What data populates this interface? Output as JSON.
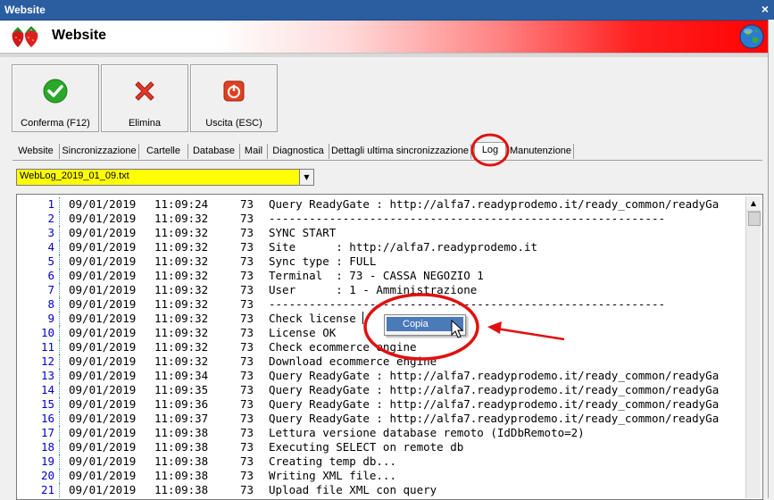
{
  "window": {
    "title": "Website",
    "close_glyph": "×"
  },
  "header": {
    "title": "Website",
    "logo_icon": "strawberry-logo-icon",
    "globe_icon": "globe-icon"
  },
  "toolbar": {
    "confirm_label": "Conferma (F12)",
    "delete_label": "Elimina",
    "exit_label": "Uscita (ESC)"
  },
  "tabs": [
    {
      "label": "Website"
    },
    {
      "label": "Sincronizzazione"
    },
    {
      "label": "Cartelle"
    },
    {
      "label": "Database"
    },
    {
      "label": "Mail"
    },
    {
      "label": "Diagnostica"
    },
    {
      "label": "Dettagli ultima sincronizzazione"
    },
    {
      "label": "Log",
      "selected": true
    },
    {
      "label": "Manutenzione"
    }
  ],
  "file_select": {
    "value": "WebLog_2019_01_09.txt",
    "arrow": "▼"
  },
  "log": {
    "rows": [
      {
        "num": "1",
        "date": "09/01/2019",
        "time": "11:09:24",
        "term": "73",
        "msg": "Query ReadyGate : http://alfa7.readyprodemo.it/ready_common/readyGa"
      },
      {
        "num": "2",
        "date": "09/01/2019",
        "time": "11:09:32",
        "term": "73",
        "msg": "-----------------------------------------------------------"
      },
      {
        "num": "3",
        "date": "09/01/2019",
        "time": "11:09:32",
        "term": "73",
        "msg": "SYNC START"
      },
      {
        "num": "4",
        "date": "09/01/2019",
        "time": "11:09:32",
        "term": "73",
        "msg": "Site      : http://alfa7.readyprodemo.it"
      },
      {
        "num": "5",
        "date": "09/01/2019",
        "time": "11:09:32",
        "term": "73",
        "msg": "Sync type : FULL"
      },
      {
        "num": "6",
        "date": "09/01/2019",
        "time": "11:09:32",
        "term": "73",
        "msg": "Terminal  : 73 - CASSA NEGOZIO 1"
      },
      {
        "num": "7",
        "date": "09/01/2019",
        "time": "11:09:32",
        "term": "73",
        "msg": "User      : 1 - Amministrazione"
      },
      {
        "num": "8",
        "date": "09/01/2019",
        "time": "11:09:32",
        "term": "73",
        "msg": "-----------------------------------------------------------"
      },
      {
        "num": "9",
        "date": "09/01/2019",
        "time": "11:09:32",
        "term": "73",
        "msg": "Check license"
      },
      {
        "num": "10",
        "date": "09/01/2019",
        "time": "11:09:32",
        "term": "73",
        "msg": "License OK"
      },
      {
        "num": "11",
        "date": "09/01/2019",
        "time": "11:09:32",
        "term": "73",
        "msg": "Check ecommerce engine"
      },
      {
        "num": "12",
        "date": "09/01/2019",
        "time": "11:09:32",
        "term": "73",
        "msg": "Download ecommerce engine"
      },
      {
        "num": "13",
        "date": "09/01/2019",
        "time": "11:09:34",
        "term": "73",
        "msg": "Query ReadyGate : http://alfa7.readyprodemo.it/ready_common/readyGa"
      },
      {
        "num": "14",
        "date": "09/01/2019",
        "time": "11:09:35",
        "term": "73",
        "msg": "Query ReadyGate : http://alfa7.readyprodemo.it/ready_common/readyGa"
      },
      {
        "num": "15",
        "date": "09/01/2019",
        "time": "11:09:36",
        "term": "73",
        "msg": "Query ReadyGate : http://alfa7.readyprodemo.it/ready_common/readyGa"
      },
      {
        "num": "16",
        "date": "09/01/2019",
        "time": "11:09:37",
        "term": "73",
        "msg": "Query ReadyGate : http://alfa7.readyprodemo.it/ready_common/readyGa"
      },
      {
        "num": "17",
        "date": "09/01/2019",
        "time": "11:09:38",
        "term": "73",
        "msg": "Lettura versione database remoto (IdDbRemoto=2)"
      },
      {
        "num": "18",
        "date": "09/01/2019",
        "time": "11:09:38",
        "term": "73",
        "msg": "Executing SELECT on remote db"
      },
      {
        "num": "19",
        "date": "09/01/2019",
        "time": "11:09:38",
        "term": "73",
        "msg": "Creating temp db..."
      },
      {
        "num": "20",
        "date": "09/01/2019",
        "time": "11:09:38",
        "term": "73",
        "msg": "Writing XML file..."
      },
      {
        "num": "21",
        "date": "09/01/2019",
        "time": "11:09:38",
        "term": "73",
        "msg": "Upload file XML con query"
      }
    ]
  },
  "context_menu": {
    "copy_label": "Copia"
  },
  "scrollbar": {
    "up_arrow": "▲"
  },
  "colors": {
    "title_bar": "#2a5ea0",
    "header_red": "#ff0000",
    "file_select_bg": "#ffff00",
    "menu_highlight": "#4a7ab8",
    "annotation": "#e01010",
    "line_number": "#0000cc"
  }
}
